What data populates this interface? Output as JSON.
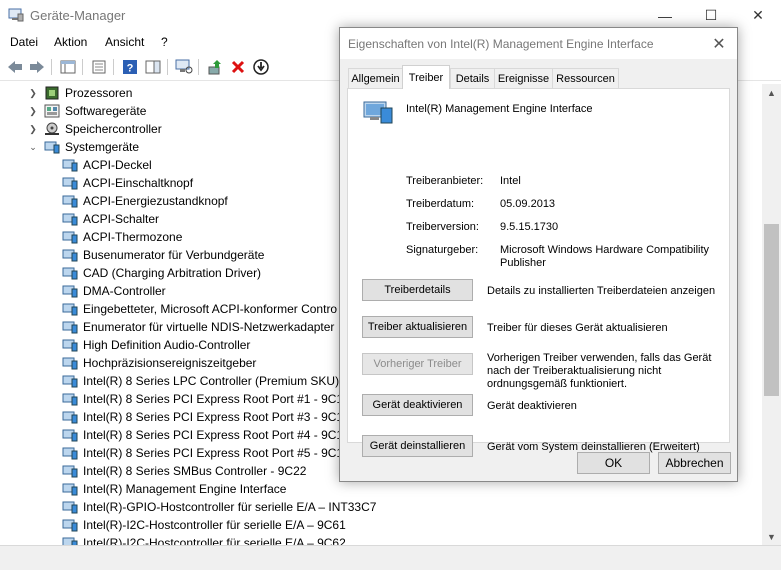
{
  "window": {
    "title": "Geräte-Manager",
    "minimize": "—",
    "maximize": "☐",
    "close": "✕"
  },
  "menu": [
    "Datei",
    "Aktion",
    "Ansicht",
    "?"
  ],
  "tree": {
    "categories": [
      {
        "label": "Prozessoren",
        "expanded": false
      },
      {
        "label": "Softwaregeräte",
        "expanded": false
      },
      {
        "label": "Speichercontroller",
        "expanded": false
      },
      {
        "label": "Systemgeräte",
        "expanded": true
      }
    ],
    "devices": [
      "ACPI-Deckel",
      "ACPI-Einschaltknopf",
      "ACPI-Energiezustandknopf",
      "ACPI-Schalter",
      "ACPI-Thermozone",
      "Busenumerator für Verbundgeräte",
      "CAD (Charging Arbitration Driver)",
      "DMA-Controller",
      "Eingebetteter, Microsoft ACPI-konformer Contro",
      "Enumerator für virtuelle NDIS-Netzwerkadapter",
      "High Definition Audio-Controller",
      "Hochpräzisionsereigniszeitgeber",
      "Intel(R) 8 Series LPC Controller (Premium SKU) - ",
      "Intel(R) 8 Series PCI Express Root Port #1 - 9C10",
      "Intel(R) 8 Series PCI Express Root Port #3 - 9C14",
      "Intel(R) 8 Series PCI Express Root Port #4 - 9C16",
      "Intel(R) 8 Series PCI Express Root Port #5 - 9C18",
      "Intel(R) 8 Series SMBus Controller - 9C22",
      "Intel(R) Management Engine Interface",
      "Intel(R)-GPIO-Hostcontroller für serielle E/A – INT33C7",
      "Intel(R)-I2C-Hostcontroller für serielle E/A – 9C61",
      "Intel(R)-I2C-Hostcontroller für serielle E/A – 9C62"
    ]
  },
  "dialog": {
    "title": "Eigenschaften von Intel(R) Management Engine Interface",
    "tabs": [
      "Allgemein",
      "Treiber",
      "Details",
      "Ereignisse",
      "Ressourcen"
    ],
    "active_tab": "Treiber",
    "device_name": "Intel(R) Management Engine Interface",
    "info": [
      {
        "label": "Treiberanbieter:",
        "value": "Intel"
      },
      {
        "label": "Treiberdatum:",
        "value": "05.09.2013"
      },
      {
        "label": "Treiberversion:",
        "value": "9.5.15.1730"
      },
      {
        "label": "Signaturgeber:",
        "value": "Microsoft Windows Hardware Compatibility Publisher"
      }
    ],
    "actions": [
      {
        "button": "Treiberdetails",
        "description": "Details zu installierten Treiberdateien anzeigen",
        "enabled": true
      },
      {
        "button": "Treiber aktualisieren",
        "description": "Treiber für dieses Gerät aktualisieren",
        "enabled": true
      },
      {
        "button": "Vorheriger Treiber",
        "description": "Vorherigen Treiber verwenden, falls das Gerät nach der Treiberaktualisierung nicht ordnungsgemäß funktioniert.",
        "enabled": false
      },
      {
        "button": "Gerät deaktivieren",
        "description": "Gerät deaktivieren",
        "enabled": true
      },
      {
        "button": "Gerät deinstallieren",
        "description": "Gerät vom System deinstallieren (Erweitert)",
        "enabled": true
      }
    ],
    "ok": "OK",
    "cancel": "Abbrechen"
  }
}
